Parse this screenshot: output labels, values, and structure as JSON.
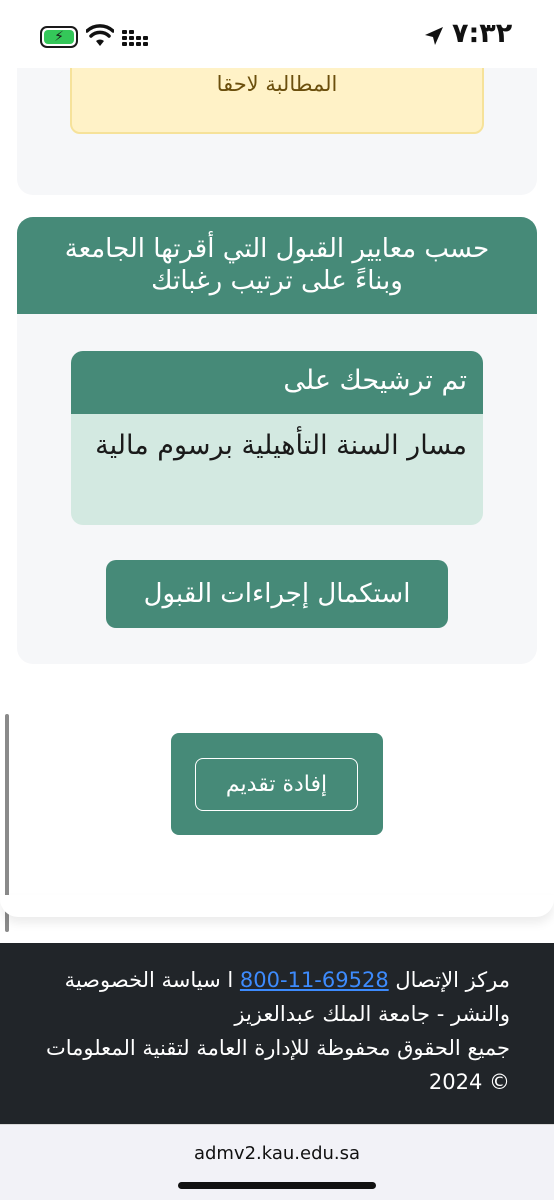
{
  "status_bar": {
    "time": "٧:٣٢",
    "battery_icon": "battery-charging-icon",
    "wifi_icon": "wifi-icon",
    "signal_icon": "cellular-signal-icon",
    "location_icon": "location-arrow-icon"
  },
  "top_card": {
    "warning_text": "المطالبة لاحقا"
  },
  "result_card": {
    "header_text": "حسب معايير القبول التي أقرتها الجامعة وبناءً على ترتيب رغباتك",
    "nominated_heading": "تم ترشيحك على",
    "nominated_program": "مسار السنة التأهيلية برسوم مالية",
    "complete_button": "استكمال إجراءات القبول"
  },
  "application_statement_button": "إفادة تقديم",
  "footer": {
    "contact_label": "مركز الإتصال",
    "phone": "800-11-69528",
    "privacy_text": "ا سياسة الخصوصية والنشر - جامعة الملك عبدالعزيز",
    "rights_text": "جميع الحقوق محفوظة للإدارة العامة لتقنية المعلومات © 2024"
  },
  "browser": {
    "url": "admv2.kau.edu.sa"
  },
  "colors": {
    "primary_green": "#468a78",
    "light_green": "#d3e9e1",
    "warning_bg": "#fff2c7",
    "footer_bg": "#212529",
    "link_blue": "#3d8bfd"
  }
}
